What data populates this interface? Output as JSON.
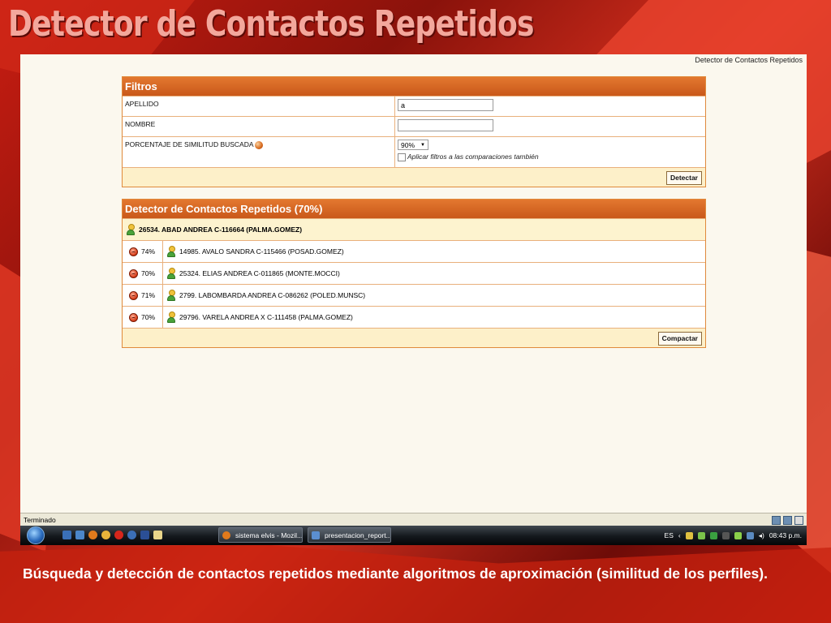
{
  "slide": {
    "title": "Detector de Contactos Repetidos",
    "caption": "Búsqueda y detección de contactos repetidos mediante algoritmos de aproximación (similitud de los perfiles)."
  },
  "page": {
    "header_link": "Detector de Contactos Repetidos"
  },
  "filters": {
    "title": "Filtros",
    "apellido_label": "APELLIDO",
    "apellido_value": "a",
    "nombre_label": "NOMBRE",
    "nombre_value": "",
    "similitud_label": "PORCENTAJE DE SIMILITUD BUSCADA",
    "similitud_value": "90%",
    "apply_filters_label": "Aplicar filtros a las comparaciones también",
    "detect_button": "Detectar"
  },
  "results": {
    "title": "Detector de Contactos Repetidos (70%)",
    "main_contact": "26534. ABAD ANDREA C-116664 (PALMA.GOMEZ)",
    "duplicates": [
      {
        "percent": "74%",
        "contact": "14985. AVALO SANDRA C-115466 (POSAD.GOMEZ)"
      },
      {
        "percent": "70%",
        "contact": "25324. ELIAS ANDREA C-011865 (MONTE.MOCCI)"
      },
      {
        "percent": "71%",
        "contact": "2799. LABOMBARDA ANDREA C-086262 (POLED.MUNSC)"
      },
      {
        "percent": "70%",
        "contact": "29796. VARELA ANDREA X C-111458 (PALMA.GOMEZ)"
      }
    ],
    "compact_button": "Compactar"
  },
  "status_bar": {
    "text": "Terminado"
  },
  "taskbar": {
    "tasks": [
      {
        "label": "sistema elvis - Mozil..."
      },
      {
        "label": "presentacion_report..."
      }
    ],
    "language": "ES",
    "time": "08:43 p.m."
  },
  "colors": {
    "panel_header": "#d0631f",
    "panel_border": "#e08a3c",
    "footer_bg": "#fdf0c9",
    "slide_bg": "#b4170f",
    "title_color": "#f3a79c"
  },
  "icons": [
    "help-icon",
    "person-icon",
    "sad-face-icon",
    "windows-orb-icon",
    "firefox-icon"
  ]
}
